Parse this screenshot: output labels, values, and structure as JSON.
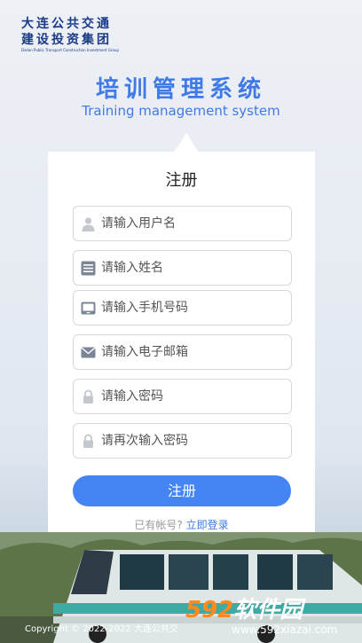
{
  "brand": {
    "line1": "大连公共交通",
    "line2": "建设投资集团",
    "line3": "Dalian Public Transport Construction Investment Group"
  },
  "header": {
    "title_cn": "培训管理系统",
    "title_en": "Training management system"
  },
  "form": {
    "title": "注册",
    "fields": [
      {
        "placeholder": "请输入用户名",
        "icon": "user-icon"
      },
      {
        "placeholder": "请输入姓名",
        "icon": "id-card-icon"
      },
      {
        "placeholder": "请输入手机号码",
        "icon": "phone-icon"
      },
      {
        "placeholder": "请输入电子邮箱",
        "icon": "mail-icon"
      },
      {
        "placeholder": "请输入密码",
        "icon": "lock-icon"
      },
      {
        "placeholder": "请再次输入密码",
        "icon": "lock-icon"
      }
    ],
    "submit_label": "注册",
    "login_prompt": "已有帐号?",
    "login_link": "立即登录"
  },
  "footer": {
    "copyright": "Copyright © 2022-2022 大连公共交"
  },
  "watermark": {
    "num": "592",
    "text": "软件园",
    "url": "www.592xiazai.com"
  },
  "colors": {
    "accent": "#3f7ae6",
    "button": "#4584f3",
    "brand_navy": "#1b3a8a"
  }
}
